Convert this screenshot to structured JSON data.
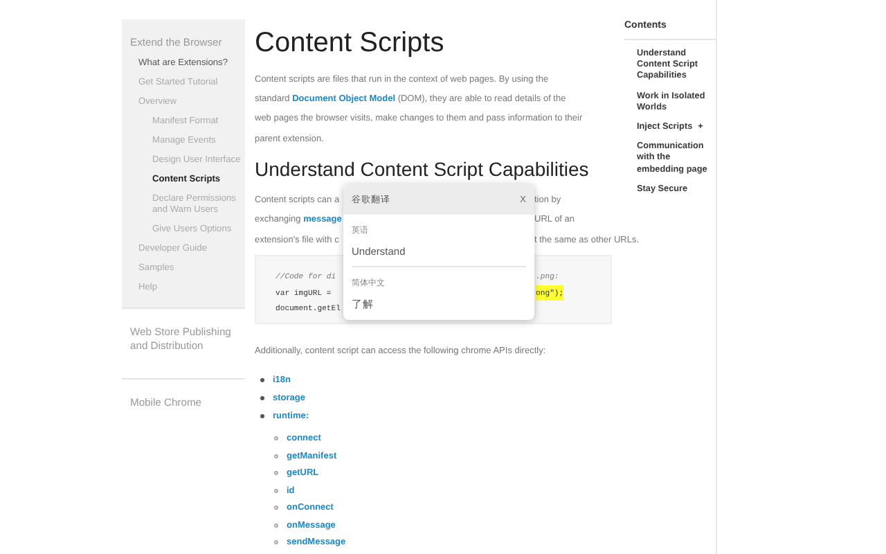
{
  "sidebar": {
    "sections": [
      {
        "label": "Extend the Browser",
        "items": [
          {
            "label": "What are Extensions?",
            "kind": "ancestor"
          },
          {
            "label": "Get Started Tutorial",
            "kind": "normal"
          },
          {
            "label": "Overview",
            "kind": "normal",
            "children": [
              {
                "label": "Manifest Format",
                "kind": "normal"
              },
              {
                "label": "Manage Events",
                "kind": "normal"
              },
              {
                "label": "Design User Interface",
                "kind": "normal"
              },
              {
                "label": "Content Scripts",
                "kind": "current"
              },
              {
                "label": "Declare Permissions and Warn Users",
                "kind": "normal"
              },
              {
                "label": "Give Users Options",
                "kind": "normal"
              }
            ]
          },
          {
            "label": "Developer Guide",
            "kind": "normal"
          },
          {
            "label": "Samples",
            "kind": "normal"
          },
          {
            "label": "Help",
            "kind": "normal"
          }
        ]
      },
      {
        "label": "Web Store Publishing and Distribution"
      },
      {
        "label": "Mobile Chrome"
      }
    ]
  },
  "main": {
    "title": "Content Scripts",
    "intro": [
      {
        "text": "Content scripts are files that run in the context of web pages. By using the standard ",
        "link": false
      },
      {
        "text": "Document Object Model",
        "link": true
      },
      {
        "text": " (DOM), they are able to read details of the web pages the browser visits, make changes to them and pass information to their parent extension.",
        "link": false
      }
    ],
    "heading": "Understand Content Script Capabilities",
    "partial_lines": [
      {
        "left": [
          {
            "text": "Content scripts can a",
            "link": false
          }
        ],
        "right": "tion by"
      },
      {
        "left": [
          {
            "text": "exchanging ",
            "link": false
          },
          {
            "text": "message",
            "link": true
          }
        ],
        "right": "URL of an"
      },
      {
        "left": [
          {
            "text": "extension's file with c",
            "link": false
          }
        ],
        "right": "t the same as other URLs."
      }
    ],
    "code_lines": [
      {
        "left": "//Code for di",
        "right": ".png:",
        "highlight": false,
        "comment": true
      },
      {
        "left": "var imgURL = ",
        "right": "ong\");",
        "highlight": true,
        "comment": false
      },
      {
        "left": "document.getEl",
        "highlight": false,
        "comment": false
      }
    ],
    "additional": "Additionally, content script can access the following chrome APIs directly:",
    "apis": [
      {
        "label": "i18n"
      },
      {
        "label": "storage"
      },
      {
        "label": "runtime:",
        "children": [
          {
            "label": "connect"
          },
          {
            "label": "getManifest"
          },
          {
            "label": "getURL"
          },
          {
            "label": "id"
          },
          {
            "label": "onConnect"
          },
          {
            "label": "onMessage"
          },
          {
            "label": "sendMessage"
          }
        ]
      }
    ]
  },
  "contents": {
    "title": "Contents",
    "items": [
      {
        "label": "Understand Content Script Capabilities"
      },
      {
        "label": "Work in Isolated Worlds"
      },
      {
        "label": "Inject Scripts",
        "toggle": "+"
      },
      {
        "label": "Communication with the embedding page"
      },
      {
        "label": "Stay Secure"
      }
    ]
  },
  "translate_popup": {
    "title": "谷歌翻译",
    "close": "X",
    "results": [
      {
        "language": "英语",
        "text": "Understand"
      },
      {
        "language": "简体中文",
        "text": "了解"
      }
    ]
  }
}
